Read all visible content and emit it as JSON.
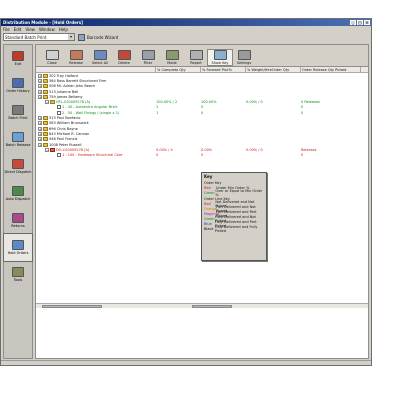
{
  "window": {
    "title": "Distribution Module - [Hold Orders]"
  },
  "menu": [
    "File",
    "Edit",
    "View",
    "Window",
    "Help"
  ],
  "toolrow": {
    "combo_value": "Standard Batch Print",
    "wizard_label": "Barcode Wizard"
  },
  "sidebar": [
    {
      "label": "Exit",
      "icon": "exit-icon",
      "color": "#c03a2a"
    },
    {
      "label": "Order History",
      "icon": "history-icon",
      "color": "#4a6fb0"
    },
    {
      "label": "Batch Print",
      "icon": "printer-icon",
      "color": "#7a7a7a"
    },
    {
      "label": "Batch Release",
      "icon": "release-icon",
      "color": "#6aa0d8"
    },
    {
      "label": "Direct Dispatch",
      "icon": "truck-icon",
      "color": "#c74a3a"
    },
    {
      "label": "Auto Dispatch",
      "icon": "auto-icon",
      "color": "#4a8a4a"
    },
    {
      "label": "Returns",
      "icon": "returns-icon",
      "color": "#a64a8a"
    },
    {
      "label": "Hold Orders",
      "icon": "hold-icon",
      "color": "#5a8ac8"
    },
    {
      "label": "Tools",
      "icon": "tools-icon",
      "color": "#8a8a5a"
    }
  ],
  "toolbar": [
    {
      "label": "Close",
      "icon": "close-icon",
      "color": "#d0d0d0"
    },
    {
      "label": "Release",
      "icon": "release-icon",
      "color": "#c47a5a"
    },
    {
      "label": "Select All",
      "icon": "select-all-icon",
      "color": "#6a8ac0"
    },
    {
      "label": "Delete",
      "icon": "delete-icon",
      "color": "#c04a3a"
    },
    {
      "label": "Filter",
      "icon": "filter-icon",
      "color": "#9aa0a8"
    },
    {
      "label": "Mode",
      "icon": "mode-icon",
      "color": "#8a9a6a"
    },
    {
      "label": "Report",
      "icon": "report-icon",
      "color": "#b0b0b0"
    },
    {
      "label": "Show Key",
      "icon": "key-icon",
      "color": "#8ab0d0"
    },
    {
      "label": "Settings",
      "icon": "settings-icon",
      "color": "#9a9a9a"
    }
  ],
  "columns": [
    "",
    "% Complete Qty",
    "% Forward Pick%",
    "% Weight/HireOrder Qty",
    "Order Release Qty Picked"
  ],
  "rows": [
    {
      "text": "302 Troy Halford",
      "level": 0,
      "kind": "folder",
      "color": "",
      "c1": "",
      "c2": "",
      "c3": "",
      "c4": ""
    },
    {
      "text": "364 Ross Barrett Structured Firm",
      "level": 0,
      "kind": "folder",
      "color": "",
      "c1": "",
      "c2": "",
      "c3": "",
      "c4": ""
    },
    {
      "text": "508 Mr. Adrian John Beech",
      "level": 0,
      "kind": "folder",
      "color": "",
      "c1": "",
      "c2": "",
      "c3": "",
      "c4": ""
    },
    {
      "text": "513 Julianne Bell",
      "level": 0,
      "kind": "folder",
      "color": "",
      "c1": "",
      "c2": "",
      "c3": "",
      "c4": ""
    },
    {
      "text": "759 James Bellamy",
      "level": 0,
      "kind": "folder",
      "color": "",
      "c1": "",
      "c2": "",
      "c3": "",
      "c4": ""
    },
    {
      "text": "HFL-CS0009278 (A)",
      "level": 1,
      "kind": "folder",
      "color": "green",
      "c1": "100.00% / 2",
      "c2": "100.00%",
      "c3": "0.00% / 0",
      "c4": "0 Releases"
    },
    {
      "text": "1 - 40 - Autoextra Angular Brick",
      "level": 2,
      "kind": "doc",
      "color": "green",
      "c1": "1",
      "c2": "0",
      "c3": "",
      "c4": "0"
    },
    {
      "text": "2 - 50 - Wall Fixings / (single x 2)",
      "level": 2,
      "kind": "doc",
      "color": "green",
      "c1": "1",
      "c2": "0",
      "c3": "",
      "c4": "0"
    },
    {
      "text": "513 Paul Bonfacio",
      "level": 0,
      "kind": "folder",
      "color": "",
      "c1": "",
      "c2": "",
      "c3": "",
      "c4": ""
    },
    {
      "text": "583 William Brunswick",
      "level": 0,
      "kind": "folder",
      "color": "",
      "c1": "",
      "c2": "",
      "c3": "",
      "c4": ""
    },
    {
      "text": "696 Chris Boyne",
      "level": 0,
      "kind": "folder",
      "color": "",
      "c1": "",
      "c2": "",
      "c3": "",
      "c4": ""
    },
    {
      "text": "843 Michael R. Cannon",
      "level": 0,
      "kind": "folder",
      "color": "",
      "c1": "",
      "c2": "",
      "c3": "",
      "c4": ""
    },
    {
      "text": "948 Paul Francis",
      "level": 0,
      "kind": "folder",
      "color": "",
      "c1": "",
      "c2": "",
      "c3": "",
      "c4": ""
    },
    {
      "text": "1008 Peter Russell",
      "level": 0,
      "kind": "folder",
      "color": "",
      "c1": "",
      "c2": "",
      "c3": "",
      "c4": ""
    },
    {
      "text": "DO-CS0009278 (A)",
      "level": 1,
      "kind": "folder-red",
      "color": "red",
      "c1": "0.00% / 4",
      "c2": "0.00%",
      "c3": "0.00% / 0",
      "c4": "Releases"
    },
    {
      "text": "1 - 100 - Hardware Structural Care",
      "level": 2,
      "kind": "doc",
      "color": "red",
      "c1": "0",
      "c2": "0",
      "c3": "",
      "c4": "0"
    }
  ],
  "key_popup": {
    "title": "Key",
    "order_header": "Order Key",
    "order_items": [
      {
        "key": "Red",
        "text": "Under Min Order %",
        "color": "#c41a12"
      },
      {
        "key": "Green",
        "text": "Over or Equal to Min Order %",
        "color": "#0a8a12"
      }
    ],
    "line_header": "Order Line Key",
    "line_items": [
      {
        "key": "Red",
        "text": "Not Delivered and Not Picked",
        "color": "#c41a12"
      },
      {
        "key": "Orange",
        "text": "Part Delivered and Not Picked",
        "color": "#d67a10"
      },
      {
        "key": "Magenta",
        "text": "Part Delivered and Part Picked",
        "color": "#b0209a"
      },
      {
        "key": "Green",
        "text": "Fully Delivered and Not Picked",
        "color": "#0a8a12"
      },
      {
        "key": "Blue",
        "text": "Fully Delivered and Part Picked",
        "color": "#1a3ca0"
      },
      {
        "key": "Black",
        "text": "Fully Delivered and Fully Picked",
        "color": "#000000"
      }
    ]
  }
}
